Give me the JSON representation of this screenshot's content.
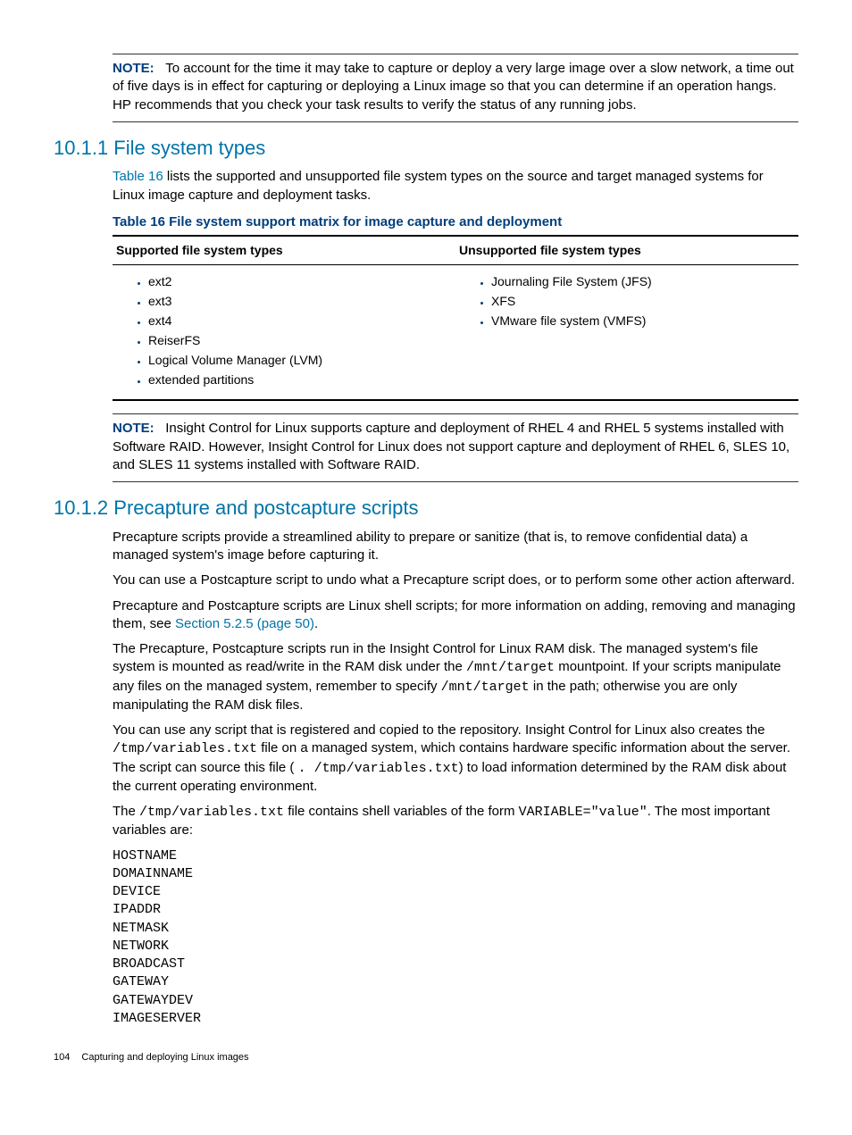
{
  "note1": {
    "label": "NOTE:",
    "text": "To account for the time it may take to capture or deploy a very large image over a slow network, a time out of five days is in effect for capturing or deploying a Linux image so that you can determine if an operation hangs. HP recommends that you check your task results to verify the status of any running jobs."
  },
  "section1": {
    "heading": "10.1.1 File system types",
    "intro_before_link": "",
    "link": "Table 16",
    "intro_after_link": " lists the supported and unsupported file system types on the source and target managed systems for Linux image capture and deployment tasks.",
    "table_caption": "Table 16 File system support matrix for image capture and deployment",
    "col1_header": "Supported file system types",
    "col2_header": "Unsupported file system types",
    "supported": [
      "ext2",
      "ext3",
      "ext4",
      "ReiserFS",
      "Logical Volume Manager (LVM)",
      "extended partitions"
    ],
    "unsupported": [
      "Journaling File System (JFS)",
      "XFS",
      "VMware file system (VMFS)"
    ]
  },
  "note2": {
    "label": "NOTE:",
    "text": "Insight Control for Linux supports capture and deployment of RHEL 4 and RHEL 5 systems installed with Software RAID. However, Insight Control for Linux does not support capture and deployment of RHEL 6, SLES 10, and SLES 11 systems installed with Software RAID."
  },
  "section2": {
    "heading": "10.1.2 Precapture and postcapture scripts",
    "p1": "Precapture scripts provide a streamlined ability to prepare or sanitize (that is, to remove confidential data) a managed system's image before capturing it.",
    "p2": "You can use a Postcapture script to undo what a Precapture script does, or to perform some other action afterward.",
    "p3_before": "Precapture and Postcapture scripts are Linux shell scripts; for more information on adding, removing and managing them, see ",
    "p3_link": "Section 5.2.5 (page 50)",
    "p3_after": ".",
    "p4_a": "The Precapture, Postcapture scripts run in the Insight Control for Linux RAM disk. The managed system's file system is mounted as read/write in the RAM disk under the ",
    "p4_m1": "/mnt/target",
    "p4_b": " mountpoint. If your scripts manipulate any files on the managed system, remember to specify ",
    "p4_m2": "/mnt/target",
    "p4_c": " in the path; otherwise you are only manipulating the RAM disk files.",
    "p5_a": "You can use any script that is registered and copied to the repository. Insight Control for Linux also creates the ",
    "p5_m1": "/tmp/variables.txt",
    "p5_b": " file on a managed system, which contains hardware specific information about the server. The script can source this file ( ",
    "p5_m2": ".  /tmp/variables.txt",
    "p5_c": ") to load information determined by the RAM disk about the current operating environment.",
    "p6_a": "The ",
    "p6_m1": "/tmp/variables.txt",
    "p6_b": " file contains shell variables of the form ",
    "p6_m2": "VARIABLE=\"value\"",
    "p6_c": ". The most important variables are:",
    "variables": "HOSTNAME\nDOMAINNAME\nDEVICE\nIPADDR\nNETMASK\nNETWORK\nBROADCAST\nGATEWAY\nGATEWAYDEV\nIMAGESERVER"
  },
  "footer": {
    "page": "104",
    "title": "Capturing and deploying Linux images"
  }
}
